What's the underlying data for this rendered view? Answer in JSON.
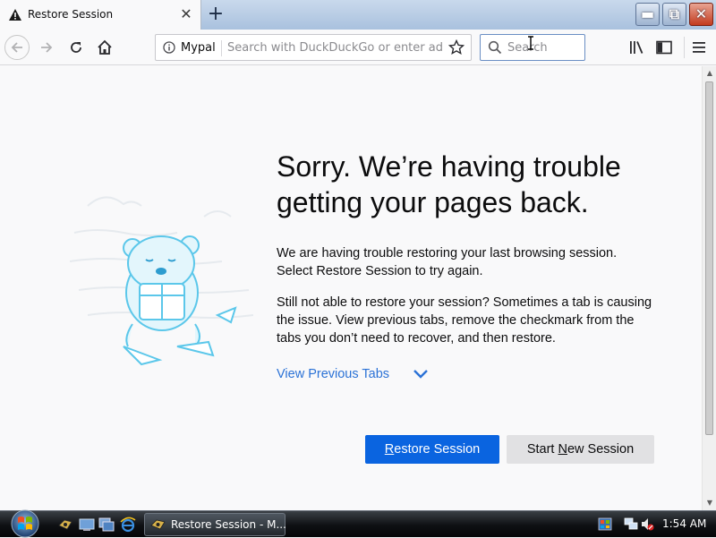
{
  "tab": {
    "title": "Restore Session",
    "close": "✕"
  },
  "newtab": "+",
  "window_buttons": {
    "minimize": "▬",
    "maximize": "⧉",
    "close": "✕"
  },
  "urlbar": {
    "site": "Mypal",
    "placeholder": "Search with DuckDuckGo or enter address"
  },
  "searchbar": {
    "placeholder": "Search"
  },
  "icons": {
    "back": "back-arrow-icon",
    "forward": "forward-arrow-icon",
    "reload": "reload-icon",
    "home": "home-icon",
    "info": "info-icon",
    "bookmark": "star-icon",
    "search": "search-icon",
    "library": "library-icon",
    "sidebar": "sidebar-icon",
    "menu": "hamburger-menu-icon",
    "tab_warning": "warning-icon",
    "start": "windows-start-icon"
  },
  "content": {
    "heading": "Sorry. We’re having trouble getting your pages back.",
    "paragraph1": "We are having trouble restoring your last browsing session. Select Restore Session to try again.",
    "paragraph2": "Still not able to restore your session? Sometimes a tab is causing the issue. View previous tabs, remove the checkmark from the tabs you don’t need to recover, and then restore.",
    "view_previous_tabs": "View Previous Tabs",
    "restore_button": {
      "access_key": "R",
      "rest": "estore Session"
    },
    "new_session_button": {
      "before": "Start ",
      "access_key": "N",
      "after": "ew Session"
    }
  },
  "taskbar": {
    "task_label": "Restore Session - M...",
    "clock": "1:54 AM"
  },
  "colors": {
    "accent": "#0a64e0",
    "link": "#2b72d6",
    "secondary_button": "#e1e1e3"
  }
}
